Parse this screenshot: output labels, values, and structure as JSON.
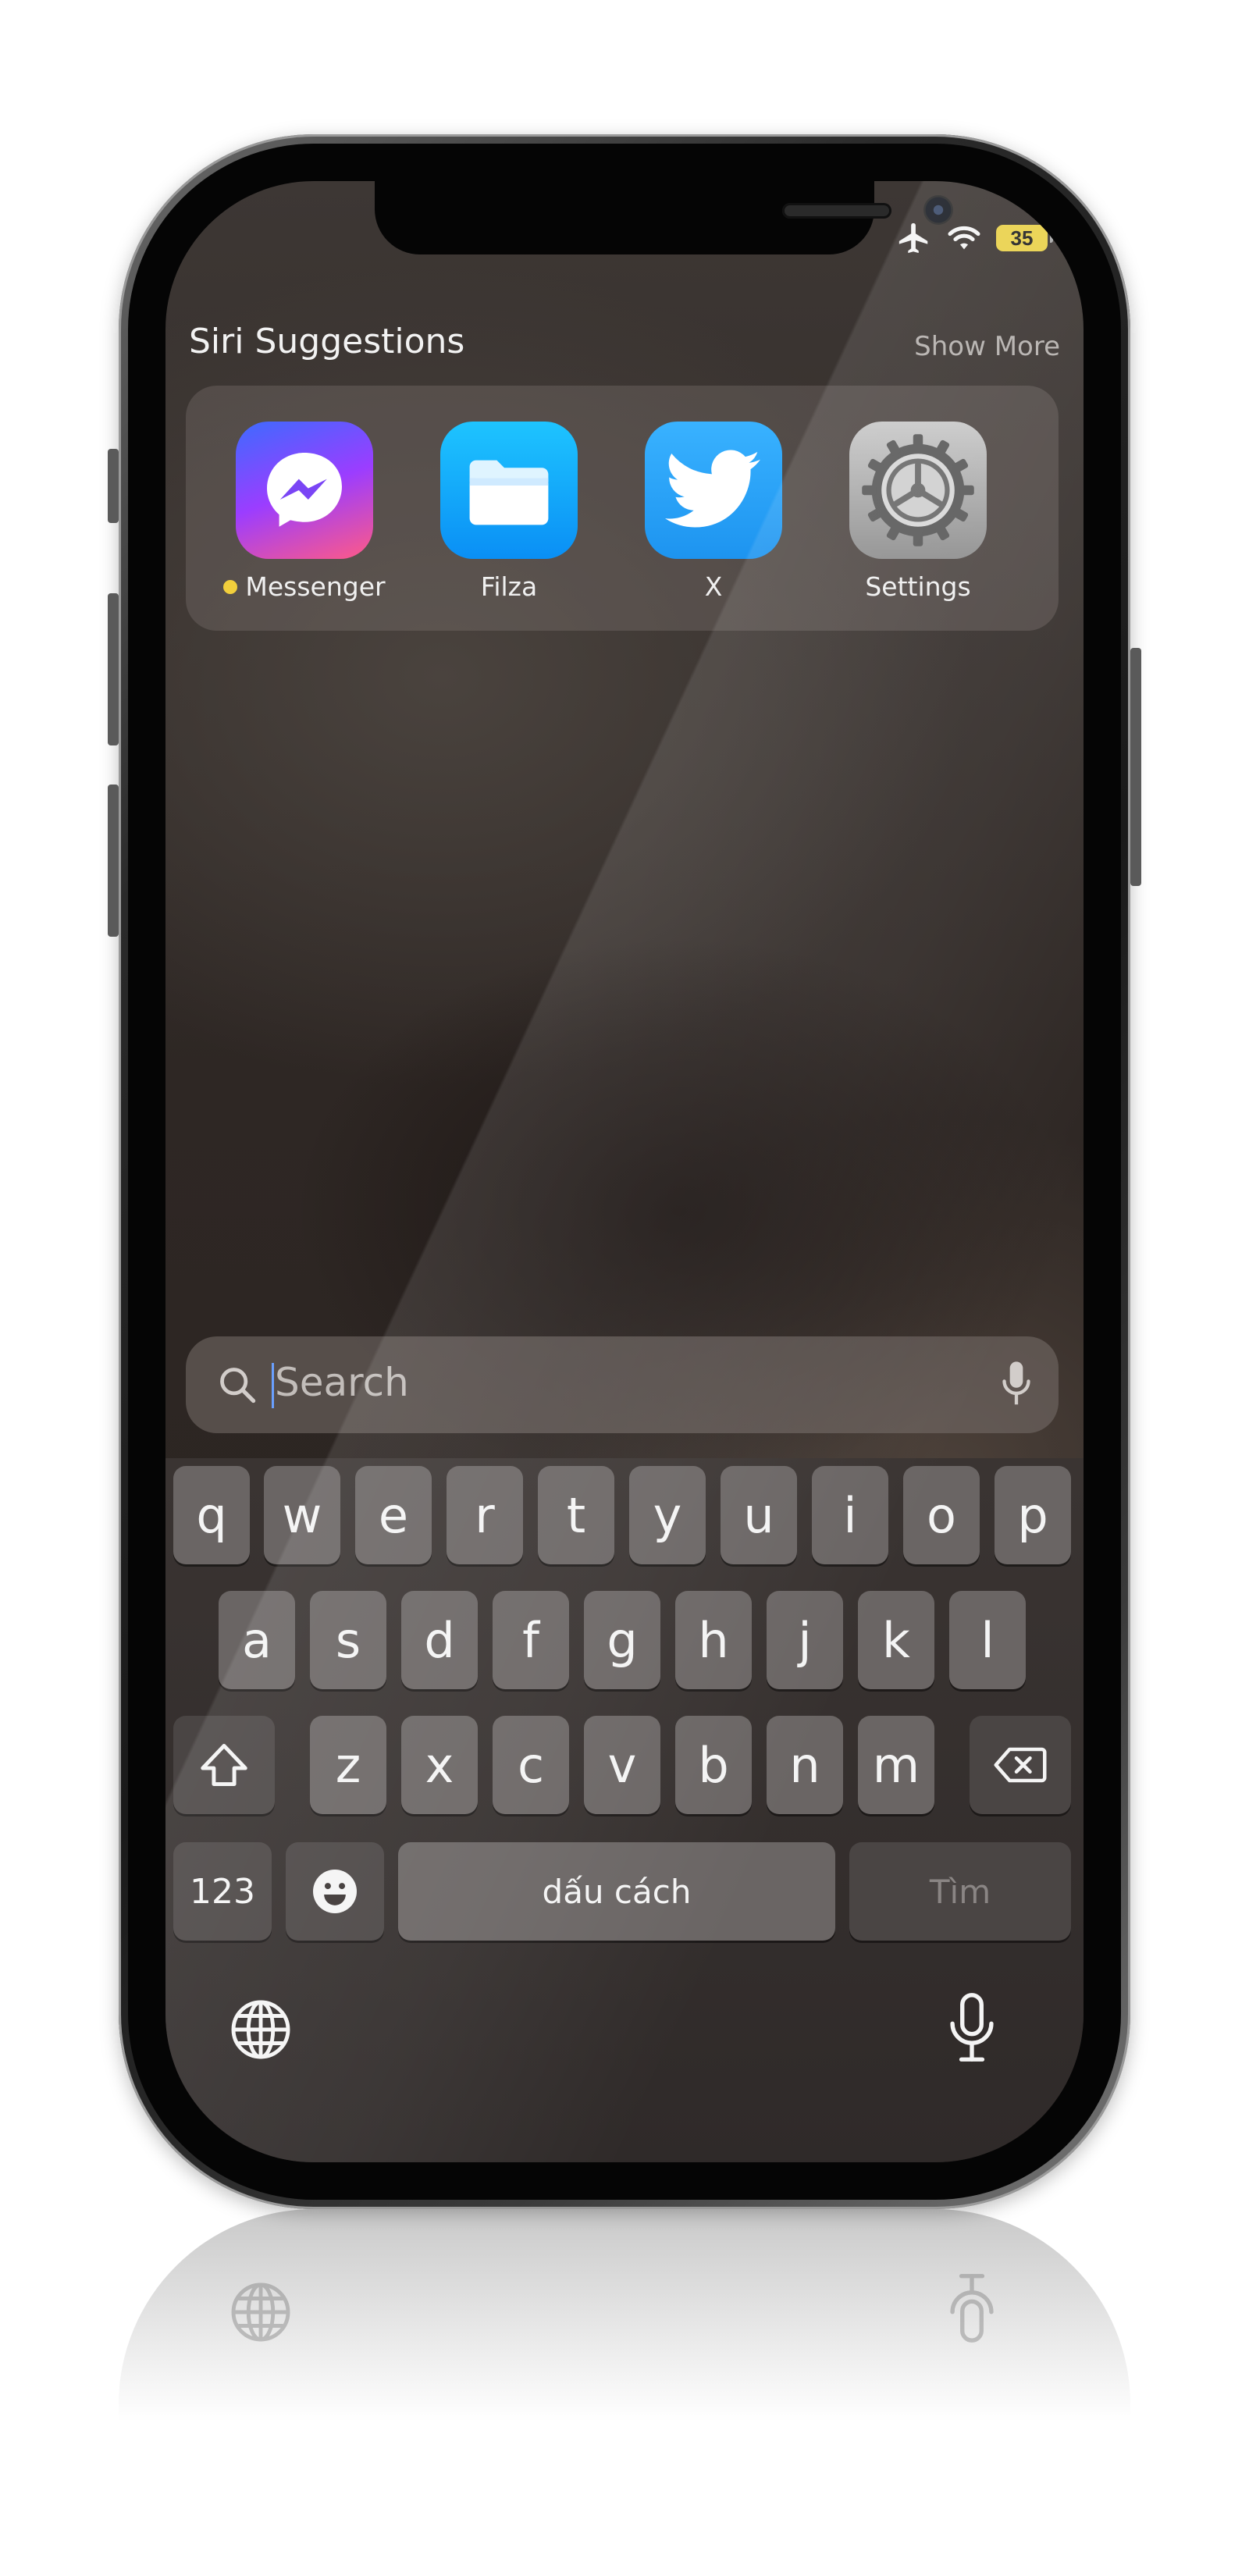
{
  "status_bar": {
    "battery_level": "35",
    "icons": [
      "airplane-icon",
      "wifi-icon",
      "battery-icon"
    ],
    "battery_color": "#e9d14a"
  },
  "siri": {
    "title": "Siri Suggestions",
    "show_more": "Show More",
    "apps": [
      {
        "label": "Messenger",
        "icon": "messenger-icon",
        "has_new_badge": true
      },
      {
        "label": "Filza",
        "icon": "folder-icon"
      },
      {
        "label": "X",
        "icon": "twitter-bird-icon"
      },
      {
        "label": "Settings",
        "icon": "gear-icon"
      }
    ]
  },
  "search": {
    "placeholder": "Search",
    "icons": [
      "search-icon",
      "microphone-icon"
    ]
  },
  "keyboard": {
    "row1": [
      "q",
      "w",
      "e",
      "r",
      "t",
      "y",
      "u",
      "i",
      "o",
      "p"
    ],
    "row2": [
      "a",
      "s",
      "d",
      "f",
      "g",
      "h",
      "j",
      "k",
      "l"
    ],
    "row3": [
      "z",
      "x",
      "c",
      "v",
      "b",
      "n",
      "m"
    ],
    "numbers_key": "123",
    "space_key": "dấu cách",
    "search_key": "Tìm",
    "icons": [
      "shift-icon",
      "backspace-icon",
      "emoji-icon",
      "globe-icon",
      "dictation-icon"
    ]
  }
}
